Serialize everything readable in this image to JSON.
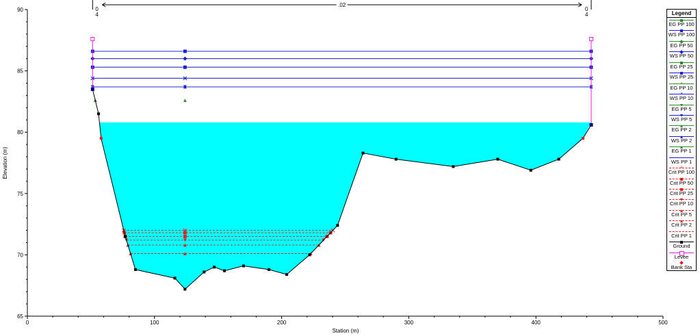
{
  "chart_data": {
    "type": "line",
    "xlabel": "Station (m)",
    "ylabel": "Elevation (m)",
    "xlim": [
      0,
      500
    ],
    "ylim": [
      65,
      90
    ],
    "x_ticks": [
      0,
      100,
      200,
      300,
      400,
      500
    ],
    "y_ticks": [
      65,
      70,
      75,
      80,
      85,
      90
    ],
    "top_labels": {
      "left_station": 51.3,
      "right_station": 443.5,
      "left_text": [
        "0",
        "4"
      ],
      "right_text": [
        "0",
        "4"
      ],
      "manning_text": ".02"
    },
    "ground": {
      "x": [
        51.3,
        56,
        58,
        77,
        85,
        116,
        124,
        139,
        147,
        155,
        170,
        190,
        204,
        222,
        244,
        264,
        290,
        335,
        370,
        396,
        418,
        437,
        443.5
      ],
      "y": [
        83.5,
        81.5,
        79.5,
        71.5,
        68.8,
        68.1,
        67.2,
        68.6,
        69,
        68.7,
        69.1,
        68.8,
        68.4,
        70,
        72.4,
        78.3,
        77.8,
        77.2,
        77.8,
        76.9,
        77.8,
        79.5,
        80.6
      ]
    },
    "bank_stations": {
      "x": [
        58,
        437
      ],
      "y": [
        79.5,
        79.5
      ]
    },
    "levees": {
      "x": [
        51.3,
        443.5
      ],
      "y": [
        87.6,
        87.6
      ]
    },
    "water_surface_fill_elevation": 80.8,
    "series": [
      {
        "name": "EG PP 100",
        "elevation": 86.6,
        "color": "#2e8b2e",
        "marker": "square",
        "dash": false
      },
      {
        "name": "WS PP 100",
        "elevation": 86.6,
        "color": "#1c1ce8",
        "marker": "square",
        "dash": false
      },
      {
        "name": "EG PP 50",
        "elevation": 86.0,
        "color": "#2e8b2e",
        "marker": "diamond",
        "dash": false
      },
      {
        "name": "WS PP 50",
        "elevation": 86.0,
        "color": "#1c1ce8",
        "marker": "diamond",
        "dash": false
      },
      {
        "name": "EG PP 25",
        "elevation": 85.3,
        "color": "#2e8b2e",
        "marker": "square",
        "dash": false
      },
      {
        "name": "WS PP 25",
        "elevation": 85.3,
        "color": "#1c1ce8",
        "marker": "square",
        "dash": false
      },
      {
        "name": "EG PP 10",
        "elevation": 84.4,
        "color": "#2e8b2e",
        "marker": "x",
        "dash": false
      },
      {
        "name": "WS PP 10",
        "elevation": 84.4,
        "color": "#1c1ce8",
        "marker": "x",
        "dash": false
      },
      {
        "name": "EG PP 5",
        "elevation": 83.7,
        "color": "#2e8b2e",
        "marker": "triangle-down",
        "dash": false
      },
      {
        "name": "WS PP 5",
        "elevation": 83.7,
        "color": "#1c1ce8",
        "marker": "triangle-down",
        "dash": false
      },
      {
        "name": "EG PP 2",
        "elevation": 83.7,
        "color": "#2e8b2e",
        "marker": "triangle",
        "dash": false
      },
      {
        "name": "WS PP 2",
        "elevation": 83.7,
        "color": "#1c1ce8",
        "marker": "triangle",
        "dash": false
      },
      {
        "name": "EG PP 1",
        "elevation": 82.6,
        "color": "#2e8b2e",
        "marker": "triangle",
        "dash": false
      },
      {
        "name": "WS PP 1",
        "elevation": 80.8,
        "color": "#1c1ce8",
        "marker": "none",
        "dash": false
      },
      {
        "name": "Crit PP 100",
        "elevation": 72.0,
        "color": "#e02020",
        "marker": "x",
        "dash": true
      },
      {
        "name": "Crit PP 50",
        "elevation": 71.8,
        "color": "#e02020",
        "marker": "square",
        "dash": true
      },
      {
        "name": "Crit PP 25",
        "elevation": 71.5,
        "color": "#e02020",
        "marker": "square",
        "dash": true
      },
      {
        "name": "Crit PP 10",
        "elevation": 71.2,
        "color": "#e02020",
        "marker": "triangle-down",
        "dash": true
      },
      {
        "name": "Crit PP 5",
        "elevation": 70.8,
        "color": "#e02020",
        "marker": "triangle",
        "dash": true
      },
      {
        "name": "Crit PP 2",
        "elevation": 70.1,
        "color": "#e02020",
        "marker": "triangle",
        "dash": true
      },
      {
        "name": "Crit PP 1",
        "elevation": 70.1,
        "color": "#e02020",
        "marker": "none",
        "dash": true
      }
    ],
    "legend": {
      "title": "Legend",
      "position": "right",
      "items": [
        {
          "label": "EG PP 100",
          "color": "#2e8b2e",
          "marker": "square",
          "dash": false
        },
        {
          "label": "WS PP 100",
          "color": "#1c1ce8",
          "marker": "square",
          "dash": false
        },
        {
          "label": "EG PP 50",
          "color": "#2e8b2e",
          "marker": "diamond",
          "dash": false
        },
        {
          "label": "WS PP 50",
          "color": "#1c1ce8",
          "marker": "diamond",
          "dash": false
        },
        {
          "label": "EG PP 25",
          "color": "#2e8b2e",
          "marker": "square",
          "dash": false
        },
        {
          "label": "WS PP 25",
          "color": "#1c1ce8",
          "marker": "square",
          "dash": false
        },
        {
          "label": "EG PP 10",
          "color": "#2e8b2e",
          "marker": "x",
          "dash": false
        },
        {
          "label": "WS PP 10",
          "color": "#1c1ce8",
          "marker": "x",
          "dash": false
        },
        {
          "label": "EG PP 5",
          "color": "#2e8b2e",
          "marker": "triangle-down",
          "dash": false
        },
        {
          "label": "WS PP 5",
          "color": "#1c1ce8",
          "marker": "triangle-down",
          "dash": false
        },
        {
          "label": "EG PP 2",
          "color": "#2e8b2e",
          "marker": "triangle",
          "dash": false
        },
        {
          "label": "WS PP 2",
          "color": "#1c1ce8",
          "marker": "triangle",
          "dash": false
        },
        {
          "label": "EG PP 1",
          "color": "#2e8b2e",
          "marker": "triangle",
          "dash": false
        },
        {
          "label": "WS PP 1",
          "color": "#1c1ce8",
          "marker": "none",
          "dash": false
        },
        {
          "label": "Crit PP 100",
          "color": "#e02020",
          "marker": "x",
          "dash": true
        },
        {
          "label": "Crit PP 50",
          "color": "#e02020",
          "marker": "square",
          "dash": true
        },
        {
          "label": "Crit PP 25",
          "color": "#e02020",
          "marker": "square",
          "dash": true
        },
        {
          "label": "Crit PP 10",
          "color": "#e02020",
          "marker": "triangle-down",
          "dash": true
        },
        {
          "label": "Crit PP 5",
          "color": "#e02020",
          "marker": "triangle",
          "dash": true
        },
        {
          "label": "Crit PP 2",
          "color": "#e02020",
          "marker": "triangle",
          "dash": true
        },
        {
          "label": "Crit PP 1",
          "color": "#e02020",
          "marker": "none",
          "dash": true
        },
        {
          "label": "Ground",
          "color": "#000000",
          "marker": "square",
          "dash": false
        },
        {
          "label": "Levee",
          "color": "#e020e0",
          "marker": "open-square",
          "dash": false
        },
        {
          "label": "Bank Sta",
          "color": "#e02020",
          "marker": "diamond",
          "dash": false,
          "no_line": true
        }
      ]
    },
    "colors": {
      "water_fill": "#00ffff",
      "ground_line": "#000000",
      "levee": "#e020e0",
      "bank_sta": "#e02020"
    }
  }
}
